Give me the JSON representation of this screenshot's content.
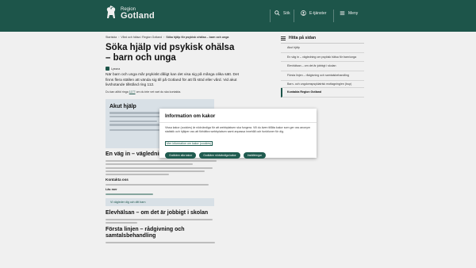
{
  "header": {
    "logo_small": "Region",
    "logo_big": "Gotland",
    "search_label": "Sök",
    "services_label": "E-tjänster",
    "menu_label": "Meny"
  },
  "breadcrumb": {
    "items": [
      "Startsida",
      "Vård och hälsa i Region Gotland",
      "Söka hjälp för psykisk ohälsa – barn och unga"
    ]
  },
  "main": {
    "title": "Söka hjälp vid psykisk ohälsa – barn och unga",
    "listen_label": "Lyssna",
    "intro": "När barn och unga mår psykiskt dåligt kan det visa sig på många olika sätt. Det finns flera ställen att vända sig till på Gotland för att få stöd eller vård. Vid akut livshotande tillstånd ring 112.",
    "note_prefix": "Du kan alltid ringa",
    "note_link": "1177",
    "note_suffix": "om du inte vet vart du ska kontakta.",
    "help_title": "Akut hjälp",
    "section1_title": "En väg in – vägledning för barn/unga",
    "contact_title": "Kontakta oss",
    "read_more": "Läs mer",
    "link_box": "Vi vägleder dig och ditt barn",
    "section2_title": "Elevhälsan – om det är jobbigt i skolan",
    "section3_title": "Första linjen – rådgivning och samtalsbehandling"
  },
  "sidebar": {
    "heading": "Hitta på sidan",
    "items": [
      "Akut hjälp",
      "En väg in – vägledning om psykisk hälsa för barn/unga",
      "Elevhälsan – om det är jobbigt i skolan",
      "Första linjen – rådgivning och samtalsbehandling",
      "Barn- och ungdomspsykiatrisk mottagning/en (bup)",
      "Kontakta Region Gotland"
    ]
  },
  "cookie_modal": {
    "title": "Information om kakor",
    "text": "Vissa kakor (cookies) är nödvändiga för att webbplatsen ska fungera. Vill du även tillåta kakor som ger oss anonym statistik och hjälper oss att förbättra webbplatsen samt anpassa innehåll och funktioner för dig.",
    "more_link": "Mer information om kakor (cookies)",
    "btn_accept_all": "Godkänn alla kakor",
    "btn_necessary": "Godkänn nödvändiga kakor",
    "btn_settings": "Inställningar"
  },
  "colors": {
    "brand": "#1f5b4f",
    "info_box": "#e6eff5"
  }
}
